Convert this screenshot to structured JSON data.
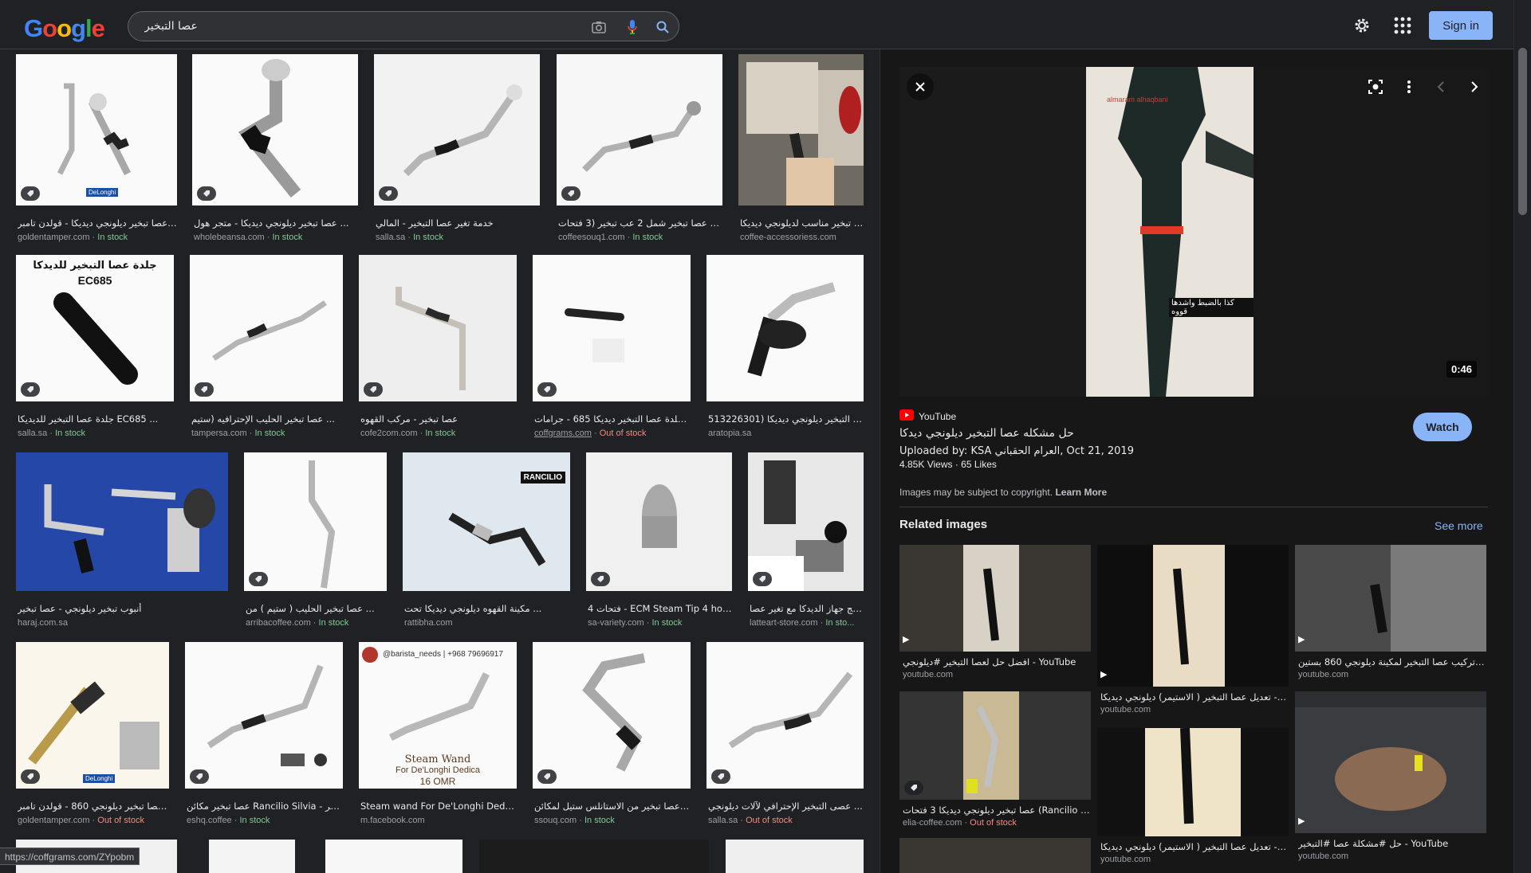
{
  "header": {
    "logo_letters": [
      "G",
      "o",
      "o",
      "g",
      "l",
      "e"
    ],
    "search_value": "عصا التبخير",
    "signin_label": "Sign in"
  },
  "results": [
    {
      "title": "عصا تبخير ديلونجي ديديكا - قولدن تامبر ...",
      "source": "goldentamper.com",
      "stock": "In stock",
      "stock_class": "in"
    },
    {
      "title": "عصا تبخير ديلونجي ديديكا - متجر هول ...",
      "source": "wholebeansa.com",
      "stock": "In stock",
      "stock_class": "in"
    },
    {
      "title": "خدمة تغير عصا التبخير - المالي",
      "source": "salla.sa",
      "stock": "In stock",
      "stock_class": "in"
    },
    {
      "title": "بكج عصا تبخير شمل 2 عب تبخير (3 فتحات ...",
      "source": "coffeesouq1.com",
      "stock": "In stock",
      "stock_class": "in"
    },
    {
      "title": "عصاء تبخير مناسب لديلونجي ديديكا ...",
      "source": "coffee-accessoriess.com",
      "stock": "",
      "stock_class": ""
    },
    {
      "title": "جلدة عصا التبخير للديديكا EC685 ...",
      "source": "salla.sa",
      "stock": "In stock",
      "stock_class": "in"
    },
    {
      "title": "عصا تبخير الحليب الإحترافيه (ستيم ...",
      "source": "tampersa.com",
      "stock": "In stock",
      "stock_class": "in"
    },
    {
      "title": "عصا تبخير - مركب القهوه",
      "source": "cofe2com.com",
      "stock": "In stock",
      "stock_class": "in"
    },
    {
      "title": "جلدة عصا التبخير ديديكا 685 - جرامات ...",
      "source": "coffgrams.com",
      "stock": "Out of stock",
      "stock_class": "out"
    },
    {
      "title": "عصا التبخير ديلونجي ديديكا (513226301...",
      "source": "aratopia.sa",
      "stock": "",
      "stock_class": ""
    },
    {
      "title": "أنبوب تبخير ديلونجي - عصا تبخير",
      "source": "haraj.com.sa",
      "stock": "",
      "stock_class": ""
    },
    {
      "title": "عصا تبخير الحليب ( ستيم ) من ...",
      "source": "arribacoffee.com",
      "stock": "In stock",
      "stock_class": "in"
    },
    {
      "title": "مكينة القهوه ديلونجي ديديكا تحت ...",
      "source": "rattibha.com",
      "stock": "",
      "stock_class": ""
    },
    {
      "title": "4 فتحات - ECM Steam Tip 4 hole...",
      "source": "sa-variety.com",
      "stock": "In stock",
      "stock_class": "in"
    },
    {
      "title": "بكج جهاز الديدكا مع تغير عصا ...",
      "source": "latteart-store.com",
      "stock": "In sto...",
      "stock_class": "in"
    },
    {
      "title": "عصا تبخير ديلونجي 860 - قولدن تامبر ...",
      "source": "goldentamper.com",
      "stock": "Out of stock",
      "stock_class": "out"
    },
    {
      "title": "عصا تبخير مكائن Rancilio Silvia - متجر...",
      "source": "eshq.coffee",
      "stock": "In stock",
      "stock_class": "in"
    },
    {
      "title": "Steam wand For De'Longhi Dedic...",
      "source": "m.facebook.com",
      "stock": "",
      "stock_class": ""
    },
    {
      "title": "عصا تبخير من الاستانلس ستيل لمكائن ...",
      "source": "ssouq.com",
      "stock": "In stock",
      "stock_class": "in"
    },
    {
      "title": "عصى التبخير الإحترافي لآلات ديلونجي ...",
      "source": "salla.sa",
      "stock": "Out of stock",
      "stock_class": "out"
    }
  ],
  "thumb_text": {
    "ec685_line1": "جلدة عصا التبخير للديدكا",
    "ec685_line2": "EC685",
    "rancilio": "RANCILIO",
    "barista": "@barista_needs | +968 79696917",
    "steam1": "Steam Wand",
    "steam2": "For De'Longhi Dedica",
    "steam3": "16 OMR",
    "delonghi": "DeLonghi"
  },
  "panel": {
    "video_overlay": "almaram alhaqbani",
    "video_caption": "كذا بالضبط واشدها قووه",
    "duration": "0:46",
    "source_name": "YouTube",
    "title": "حل مشكله عصا التبخير ديلونجي ديدكا",
    "uploaded_line": "Uploaded by: KSA العرام الحقباني, Oct 21, 2019",
    "views": "4.85K Views",
    "likes": "65 Likes",
    "watch_label": "Watch",
    "copyright_text": "Images may be subject to copyright.",
    "learn_more": "Learn More",
    "related_heading": "Related images",
    "see_more": "See more"
  },
  "related": [
    {
      "title": "افضل حل لعصا التبخير #ديلونجي - YouTube",
      "source": "youtube.com",
      "stock": ""
    },
    {
      "title": "تعديل عصا التبخير ( الاستيمر) ديلونجي ديديكا - YouTube...",
      "source": "youtube.com",
      "stock": ""
    },
    {
      "title": "طريقة تركيب عصا التبخير لمكينة ديلونجي 860 بستين...",
      "source": "youtube.com",
      "stock": ""
    },
    {
      "title": "عصا تبخير ديلونجي ديديكا 3 فتحات (Rancilio Silvia...",
      "source": "elia-coffee.com",
      "stock": "Out of stock"
    },
    {
      "title": "تعديل عصا التبخير ( الاستيمر) ديلونجي ديديكا - YouTube...",
      "source": "youtube.com",
      "stock": ""
    },
    {
      "title": "حل #مشكلة عصا #التبخير - YouTube",
      "source": "youtube.com",
      "stock": ""
    }
  ],
  "status_url": "https://coffgrams.com/ZYpobm",
  "colors": {
    "accent": "#8ab4f8",
    "in_stock": "#81c995",
    "out_of_stock": "#f28b82",
    "bg": "#202124"
  }
}
